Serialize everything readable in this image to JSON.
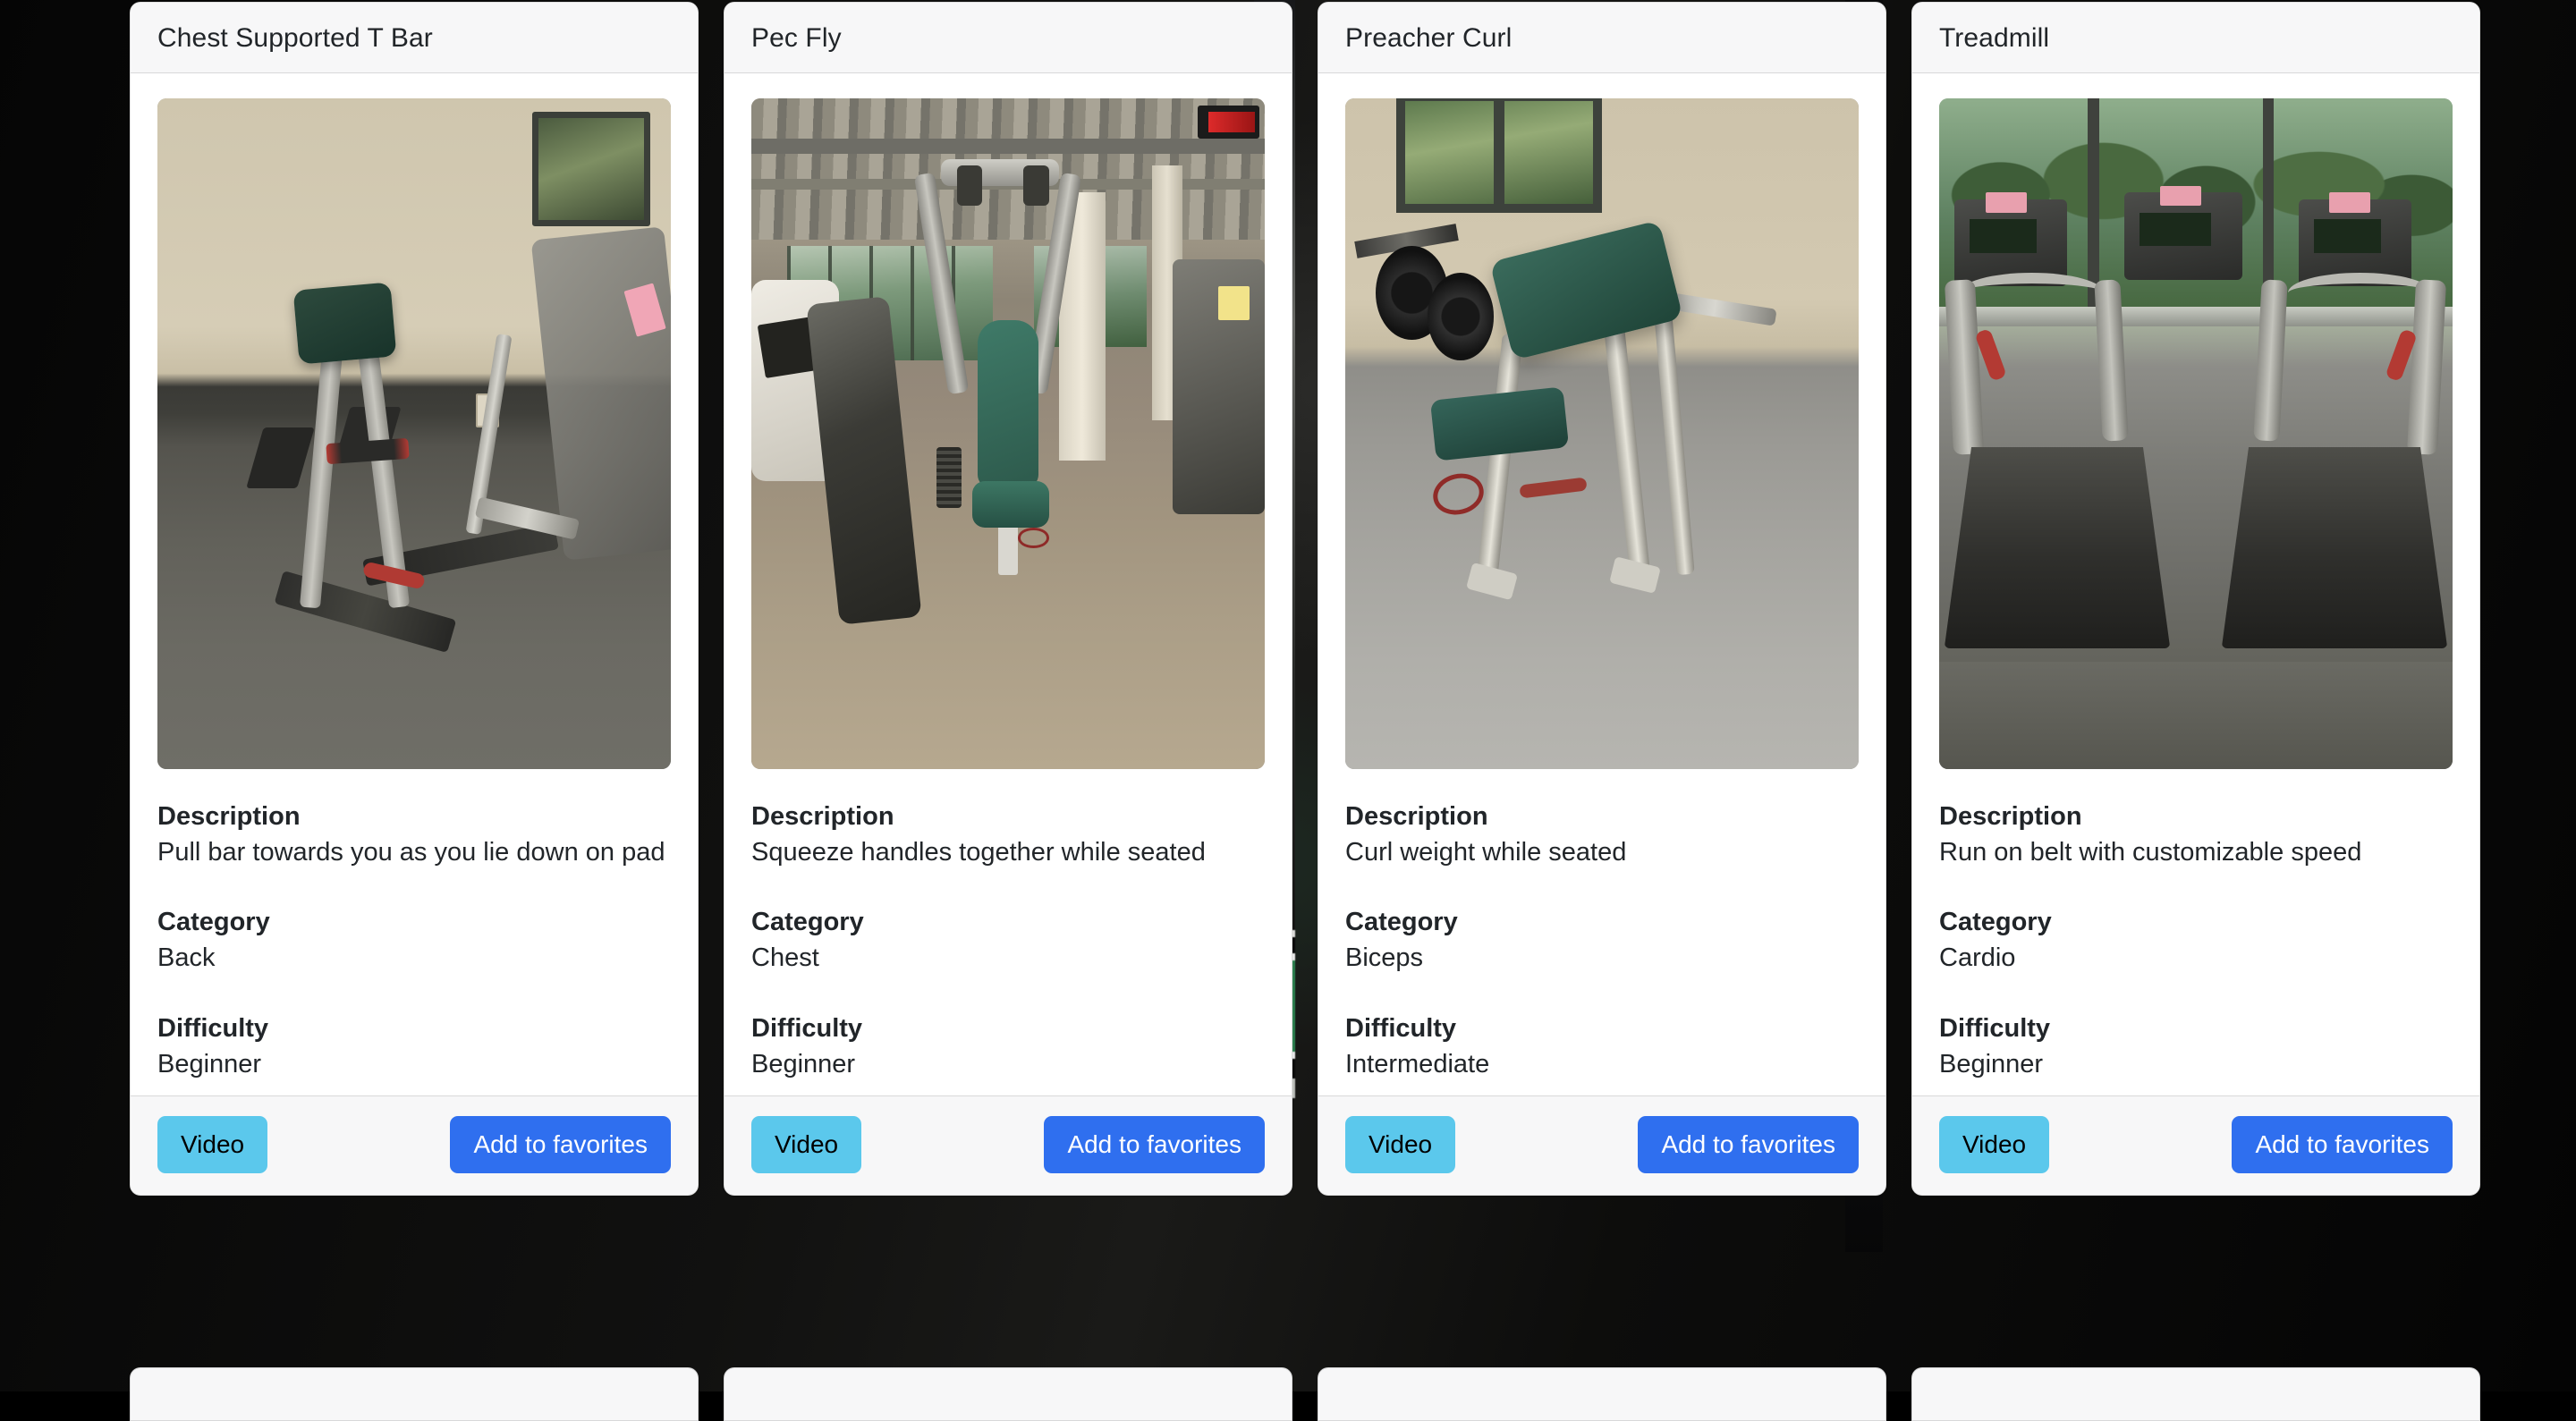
{
  "theme": {
    "page_background": "#070707",
    "card_background": "#ffffff",
    "card_header_background": "#f7f7f8",
    "card_footer_background": "#f7f7f8",
    "text_color": "#212529",
    "video_button_color": "#5bc8ec",
    "video_button_text_color": "#000000",
    "favorites_button_color": "#2f6fef",
    "favorites_button_text_color": "#ffffff"
  },
  "labels": {
    "description": "Description",
    "category": "Category",
    "difficulty": "Difficulty",
    "video_button": "Video",
    "favorites_button": "Add to favorites"
  },
  "cards": [
    {
      "title": "Chest Supported T Bar",
      "image_alt": "chest-supported-t-bar-machine-photo",
      "description": "Pull bar towards you as you lie down on pad",
      "category": "Back",
      "difficulty": "Beginner",
      "video_button": "Video",
      "favorites_button": "Add to favorites"
    },
    {
      "title": "Pec Fly",
      "image_alt": "pec-fly-machine-photo",
      "description": "Squeeze handles together while seated",
      "category": "Chest",
      "difficulty": "Beginner",
      "video_button": "Video",
      "favorites_button": "Add to favorites"
    },
    {
      "title": "Preacher Curl",
      "image_alt": "preacher-curl-bench-photo",
      "description": "Curl weight while seated",
      "category": "Biceps",
      "difficulty": "Intermediate",
      "video_button": "Video",
      "favorites_button": "Add to favorites"
    },
    {
      "title": "Treadmill",
      "image_alt": "treadmill-row-photo",
      "description": "Run on belt with customizable speed",
      "category": "Cardio",
      "difficulty": "Beginner",
      "video_button": "Video",
      "favorites_button": "Add to favorites"
    }
  ],
  "next_row_stub_count": 4
}
